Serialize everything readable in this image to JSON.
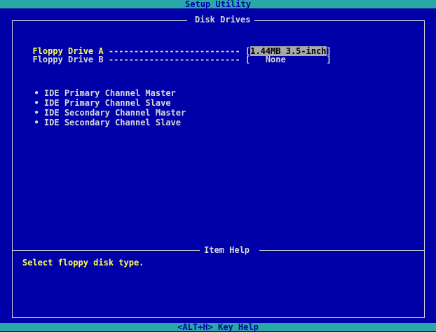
{
  "app": {
    "title": "Setup Utility"
  },
  "page": {
    "title": "Disk Drives"
  },
  "settings": [
    {
      "label": "Floppy Drive A",
      "dashes": "--------------------------",
      "value": "1.44MB 3.5-inch",
      "selected": true
    },
    {
      "label": "Floppy Drive B",
      "dashes": "--------------------------",
      "value": "   None    ",
      "selected": false
    }
  ],
  "submenus": [
    "IDE Primary Channel Master",
    "IDE Primary Channel Slave",
    "IDE Secondary Channel Master",
    "IDE Secondary Channel Slave"
  ],
  "bullet": "•",
  "help": {
    "title": "Item Help",
    "text": "Select floppy disk type."
  },
  "footer": {
    "hint": "<ALT+H>  Key Help"
  },
  "colors": {
    "background": "#0000a8",
    "bar": "#2aa8a8",
    "label": "#ffff54",
    "text": "#d8d8d8",
    "highlight": "#a8a8a8"
  }
}
